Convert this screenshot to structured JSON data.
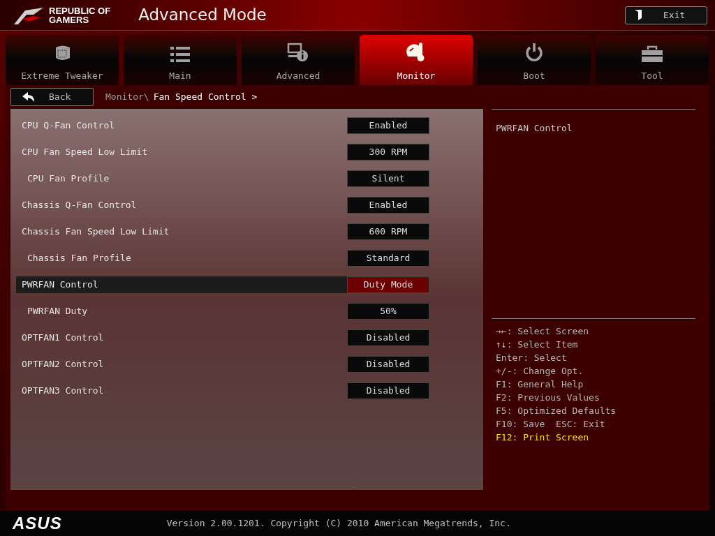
{
  "header": {
    "logo_line1": "REPUBLIC OF",
    "logo_line2": "GAMERS",
    "title": "Advanced Mode",
    "exit_button": "Exit"
  },
  "tabs": [
    {
      "label": "Extreme Tweaker",
      "kind": "tweaker",
      "selected": false
    },
    {
      "label": "Main",
      "kind": "list",
      "selected": false
    },
    {
      "label": "Advanced",
      "kind": "info",
      "selected": false
    },
    {
      "label": "Monitor",
      "kind": "monitor",
      "selected": true
    },
    {
      "label": "Boot",
      "kind": "power",
      "selected": false
    },
    {
      "label": "Tool",
      "kind": "toolbox",
      "selected": false
    }
  ],
  "back_button": "Back",
  "breadcrumb": {
    "parent": "Monitor\\",
    "current": "Fan Speed Control >"
  },
  "settings": [
    {
      "label": "CPU Q-Fan Control",
      "value": "Enabled",
      "selected": false
    },
    {
      "label": "CPU Fan Speed Low Limit",
      "value": "300 RPM",
      "selected": false,
      "children": [
        {
          "label": "CPU Fan Profile",
          "value": "Silent",
          "selected": false
        }
      ]
    },
    {
      "label": "Chassis Q-Fan Control",
      "value": "Enabled",
      "selected": false
    },
    {
      "label": "Chassis Fan Speed Low Limit",
      "value": "600 RPM",
      "selected": false,
      "children": [
        {
          "label": "Chassis Fan Profile",
          "value": "Standard",
          "selected": false
        }
      ]
    },
    {
      "label": "PWRFAN Control",
      "value": "Duty Mode",
      "selected": true,
      "children": [
        {
          "label": "PWRFAN Duty",
          "value": "50%",
          "selected": false
        }
      ]
    },
    {
      "label": "OPTFAN1 Control",
      "value": "Disabled",
      "selected": false
    },
    {
      "label": "OPTFAN2 Control",
      "value": "Disabled",
      "selected": false
    },
    {
      "label": "OPTFAN3 Control",
      "value": "Disabled",
      "selected": false
    }
  ],
  "help_text": "PWRFAN Control",
  "key_help": [
    {
      "text": "→←: Select Screen",
      "highlight": false
    },
    {
      "text": "↑↓: Select Item",
      "highlight": false
    },
    {
      "text": "Enter: Select",
      "highlight": false
    },
    {
      "text": "+/-: Change Opt.",
      "highlight": false
    },
    {
      "text": "F1: General Help",
      "highlight": false
    },
    {
      "text": "F2: Previous Values",
      "highlight": false
    },
    {
      "text": "F5: Optimized Defaults",
      "highlight": false
    },
    {
      "text": "F10: Save  ESC: Exit",
      "highlight": false
    },
    {
      "text": "F12: Print Screen",
      "highlight": true
    }
  ],
  "footer": {
    "brand": "ASUS",
    "version": "Version 2.00.1201. Copyright (C) 2010 American Megatrends, Inc."
  }
}
